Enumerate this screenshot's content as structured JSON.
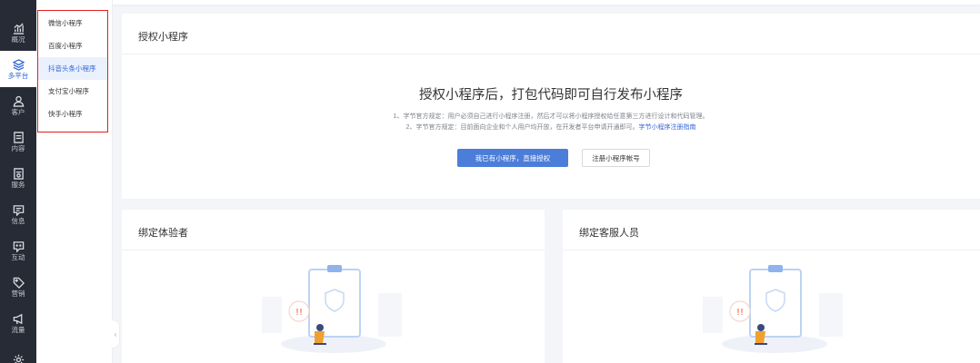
{
  "nav": {
    "items": [
      {
        "icon": "chart-icon",
        "label": "概况"
      },
      {
        "icon": "layers-icon",
        "label": "多平台",
        "active": true
      },
      {
        "icon": "user-icon",
        "label": "客户"
      },
      {
        "icon": "document-icon",
        "label": "内容"
      },
      {
        "icon": "service-icon",
        "label": "服务"
      },
      {
        "icon": "message-icon",
        "label": "信息"
      },
      {
        "icon": "interact-icon",
        "label": "互动"
      },
      {
        "icon": "tag-icon",
        "label": "营销"
      },
      {
        "icon": "megaphone-icon",
        "label": "流量"
      },
      {
        "icon": "gear-icon",
        "label": ""
      }
    ]
  },
  "submenu": {
    "items": [
      {
        "label": "微信小程序"
      },
      {
        "label": "百度小程序"
      },
      {
        "label": "抖音头条小程序",
        "active": true
      },
      {
        "label": "支付宝小程序"
      },
      {
        "label": "快手小程序"
      }
    ]
  },
  "collapse": {
    "glyph": "‹"
  },
  "authorize": {
    "title": "授权小程序",
    "headline": "授权小程序后，打包代码即可自行发布小程序",
    "note1": "1、字节官方规定：用户必须自己进行小程序注册，然后才可以将小程序授权给任意第三方进行设计和代码管理。",
    "note2_prefix": "2、字节官方规定：目前面向企业和个人用户均开放，在开发者平台申请开通即可。",
    "note2_link": "字节小程序注册指南",
    "primary_button": "我已有小程序，直接授权",
    "secondary_button": "注册小程序帐号"
  },
  "bind_tester": {
    "title": "绑定体验者"
  },
  "bind_service": {
    "title": "绑定客服人员"
  },
  "colors": {
    "accent": "#2f64d8",
    "nav_bg": "#272b35",
    "button": "#4c7ed9",
    "highlight": "#e02020"
  }
}
